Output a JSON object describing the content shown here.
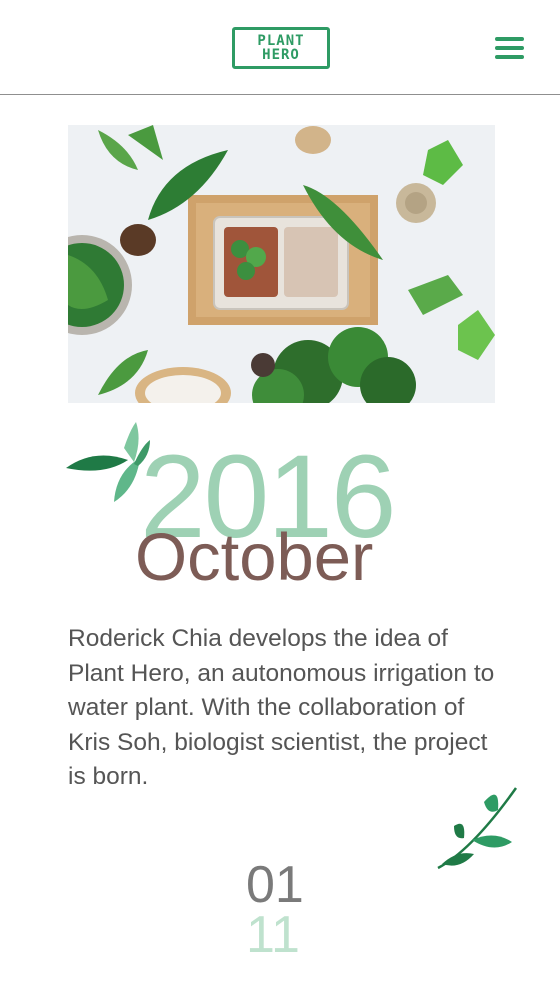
{
  "header": {
    "logo_line1": "PLANT",
    "logo_line2": "HERO"
  },
  "timeline": {
    "year": "2016",
    "month": "October",
    "description": "Roderick Chia develops the idea of Plant Hero, an autonomous irrigation to water plant. With the collaboration of Kris Soh, biologist scientist, the project is born.",
    "page_current": "01",
    "page_total": "11"
  },
  "colors": {
    "brand_green": "#2e9b64",
    "year_green": "#9ed1b4",
    "month_brown": "#7d5c56"
  }
}
